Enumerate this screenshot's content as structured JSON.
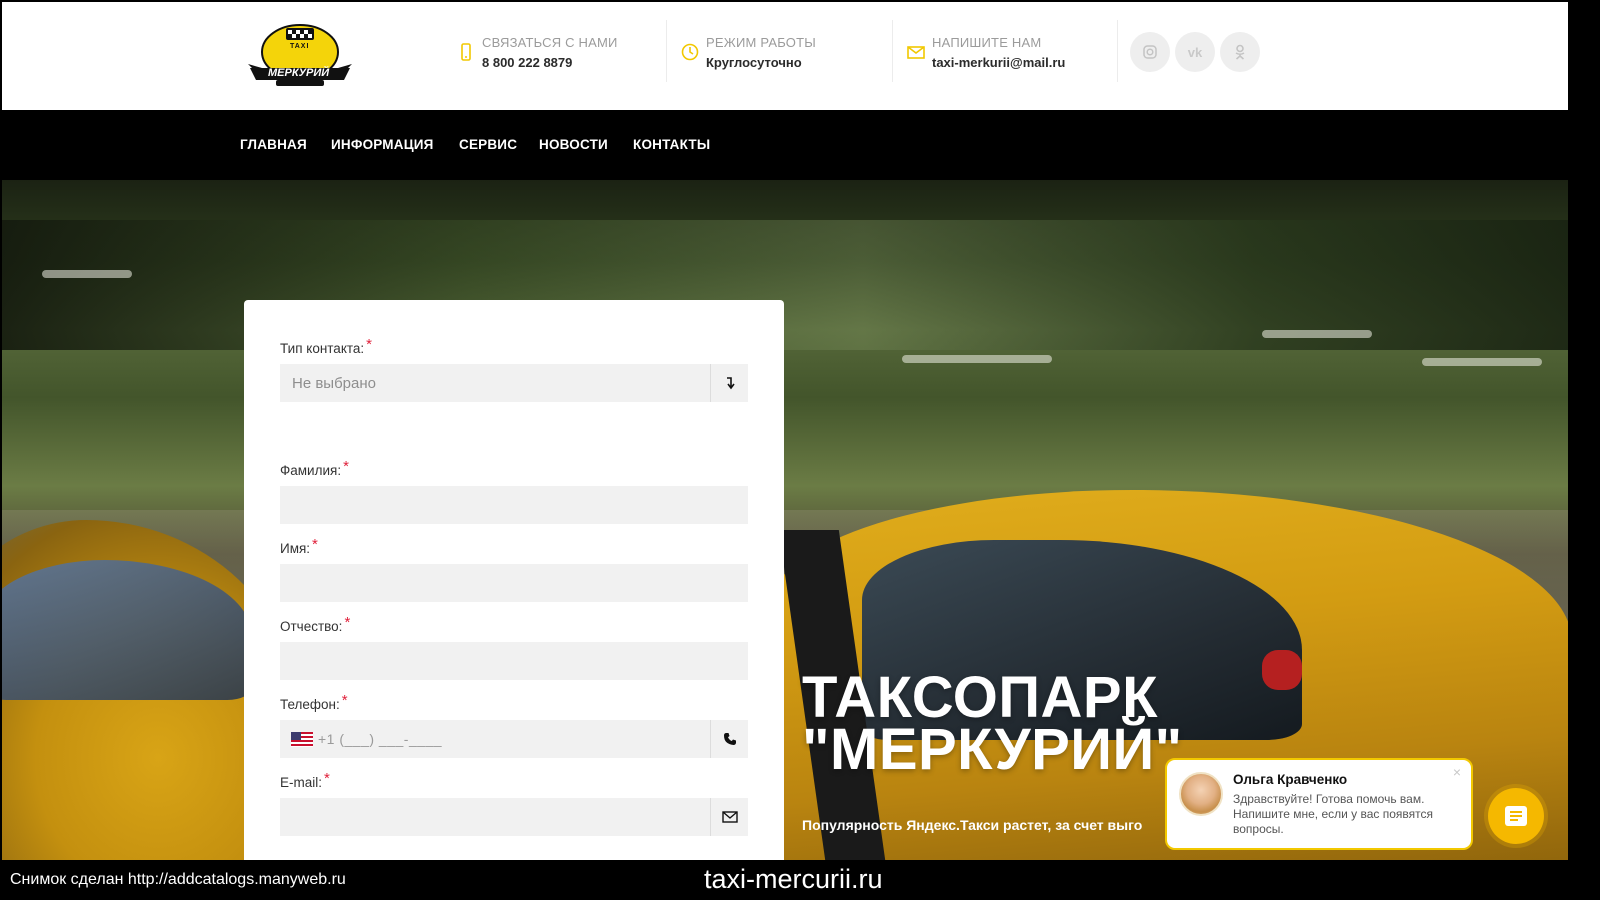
{
  "logo": {
    "badge": "TAXI",
    "name": "МЕРКУРИЙ"
  },
  "header": {
    "contacts": [
      {
        "icon": "phone-icon",
        "title": "СВЯЗАТЬСЯ С НАМИ",
        "value": "8 800 222 8879"
      },
      {
        "icon": "clock-icon",
        "title": "РЕЖИМ РАБОТЫ",
        "value": "Круглосуточно"
      },
      {
        "icon": "mail-icon",
        "title": "НАПИШИТЕ НАМ",
        "value": "taxi-merkurii@mail.ru"
      }
    ],
    "social": [
      {
        "icon": "instagram-icon"
      },
      {
        "icon": "vk-icon",
        "label": "vk"
      },
      {
        "icon": "odnoklassniki-icon"
      }
    ]
  },
  "nav": {
    "items": [
      {
        "label": "ГЛАВНАЯ"
      },
      {
        "label": "ИНФОРМАЦИЯ"
      },
      {
        "label": "СЕРВИС"
      },
      {
        "label": "НОВОСТИ"
      },
      {
        "label": "КОНТАКТЫ"
      }
    ]
  },
  "form": {
    "required_mark": "*",
    "contact_type": {
      "label": "Тип контакта:",
      "placeholder": "Не выбрано",
      "icon": "sort-arrow-icon"
    },
    "last_name": {
      "label": "Фамилия:"
    },
    "first_name": {
      "label": "Имя:"
    },
    "patronymic": {
      "label": "Отчество:"
    },
    "phone": {
      "label": "Телефон:",
      "placeholder": "+1 (___) ___-____",
      "icon": "phone-icon",
      "flag": "us-flag-icon"
    },
    "email": {
      "label": "E-mail:",
      "icon": "envelope-icon"
    }
  },
  "hero": {
    "title_line1": "ТАКСОПАРК",
    "title_line2": "\"МЕРКУРИЙ\"",
    "subtitle": "Популярность Яндекс.Такси растет, за счет выгодных условий для"
  },
  "chat": {
    "agent_name": "Ольга Кравченко",
    "message": "Здравствуйте! Готова помочь вам. Напишите мне, если у вас появятся вопросы.",
    "close": "×",
    "accent": "#f5b800"
  },
  "caption": {
    "left": "Снимок сделан http://addcatalogs.manyweb.ru",
    "center": "taxi-mercurii.ru"
  },
  "colors": {
    "accent": "#f2c800",
    "required": "#e0213b",
    "nav_bg": "#000000"
  }
}
